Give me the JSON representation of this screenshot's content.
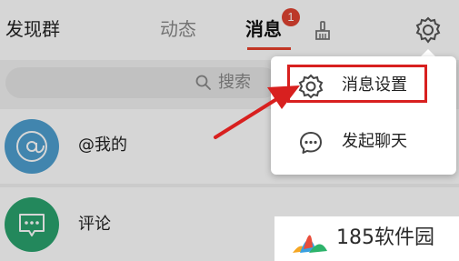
{
  "header": {
    "tabs": [
      {
        "label": "发现群",
        "active": false
      },
      {
        "label": "动态",
        "active": false
      },
      {
        "label": "消息",
        "active": true
      }
    ],
    "messages_badge": "1",
    "icons": [
      "broom-icon",
      "gear-icon"
    ]
  },
  "search": {
    "placeholder": "搜索"
  },
  "list": {
    "items": [
      {
        "label": "@我的",
        "icon": "at-icon",
        "color": "#4e9fd0"
      },
      {
        "label": "评论",
        "icon": "comment-icon",
        "color": "#2aa36e"
      }
    ]
  },
  "menu": {
    "items": [
      {
        "label": "消息设置",
        "icon": "gear-icon",
        "highlighted": true
      },
      {
        "label": "发起聊天",
        "icon": "chat-bubble-icon",
        "highlighted": false
      }
    ]
  },
  "annotation": {
    "highlight_color": "#d8201f"
  },
  "watermark": {
    "text": "185软件园"
  },
  "colors": {
    "accent": "#e8412c",
    "badge": "#e04332"
  }
}
